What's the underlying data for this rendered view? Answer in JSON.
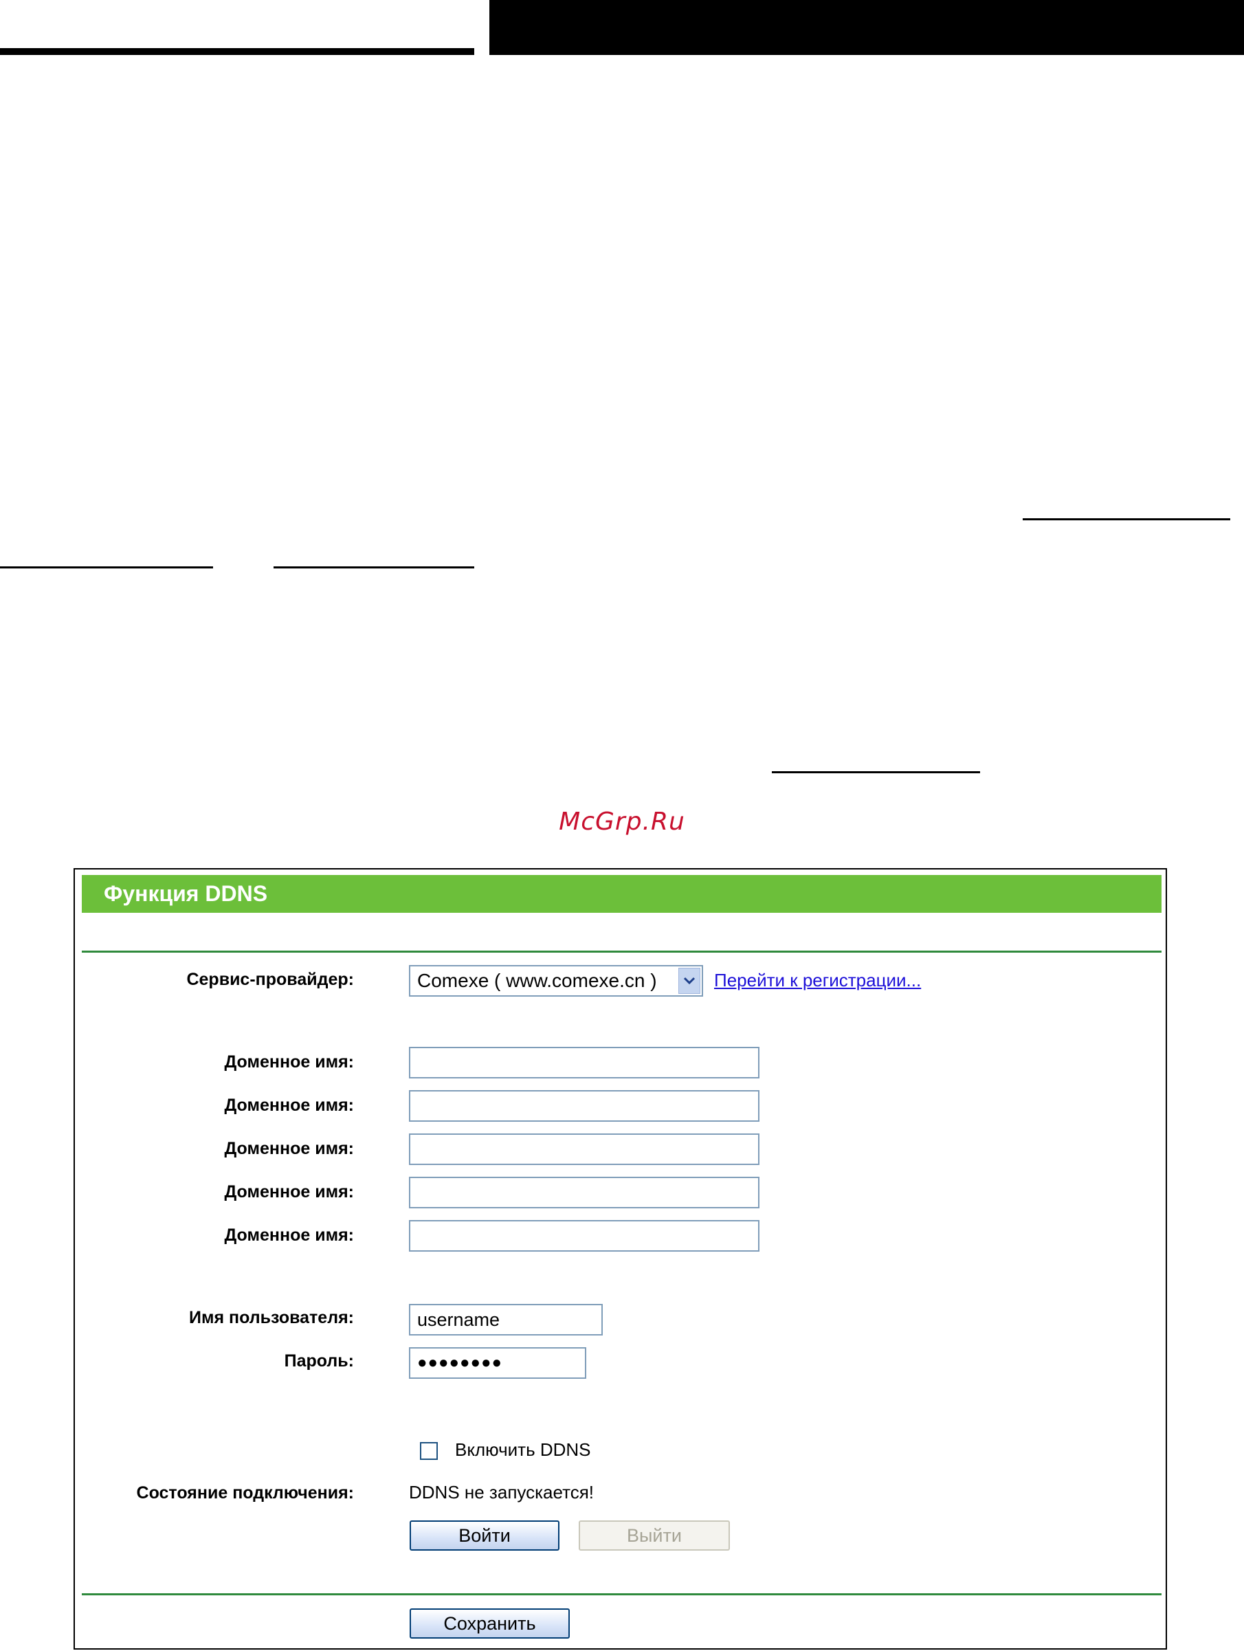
{
  "watermark": "McGrp.Ru",
  "panel": {
    "title": "Функция DDNS",
    "provider": {
      "label": "Сервис-провайдер:",
      "selected": "Comexe ( www.comexe.cn )",
      "register_link": "Перейти к регистрации..."
    },
    "domains": [
      {
        "label": "Доменное имя:",
        "value": ""
      },
      {
        "label": "Доменное имя:",
        "value": ""
      },
      {
        "label": "Доменное имя:",
        "value": ""
      },
      {
        "label": "Доменное имя:",
        "value": ""
      },
      {
        "label": "Доменное имя:",
        "value": ""
      }
    ],
    "username": {
      "label": "Имя пользователя:",
      "value": "username"
    },
    "password": {
      "label": "Пароль:",
      "value": "●●●●●●●●"
    },
    "enable_ddns": {
      "label": "Включить DDNS",
      "checked": false
    },
    "connection_status": {
      "label": "Состояние подключения:",
      "value": "DDNS не запускается!"
    },
    "buttons": {
      "login": "Войти",
      "logout": "Выйти",
      "save": "Сохранить"
    }
  },
  "colors": {
    "titlebar": "#6cbf3a",
    "divider": "#2f8a3c",
    "link": "#1c0fd8",
    "watermark": "#c8102e"
  }
}
